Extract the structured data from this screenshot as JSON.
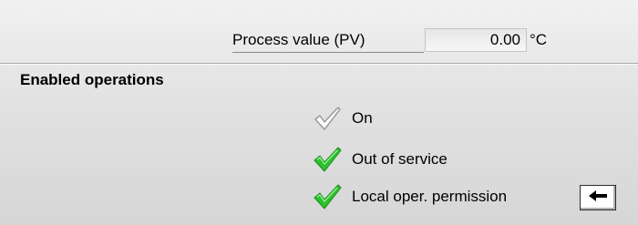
{
  "process_value": {
    "label": "Process value (PV)",
    "value": "0.00",
    "unit": "°C"
  },
  "enabled_operations": {
    "title": "Enabled operations",
    "items": [
      {
        "label": "On",
        "icon": "check-outline-icon",
        "enabled": false
      },
      {
        "label": "Out of service",
        "icon": "check-green-icon",
        "enabled": true
      },
      {
        "label": "Local oper. permission",
        "icon": "check-green-icon",
        "enabled": true
      }
    ]
  },
  "nav_button": {
    "icon": "arrow-left-icon"
  },
  "colors": {
    "check_green": "#2ec02e",
    "check_disabled": "#b8b8b8"
  }
}
